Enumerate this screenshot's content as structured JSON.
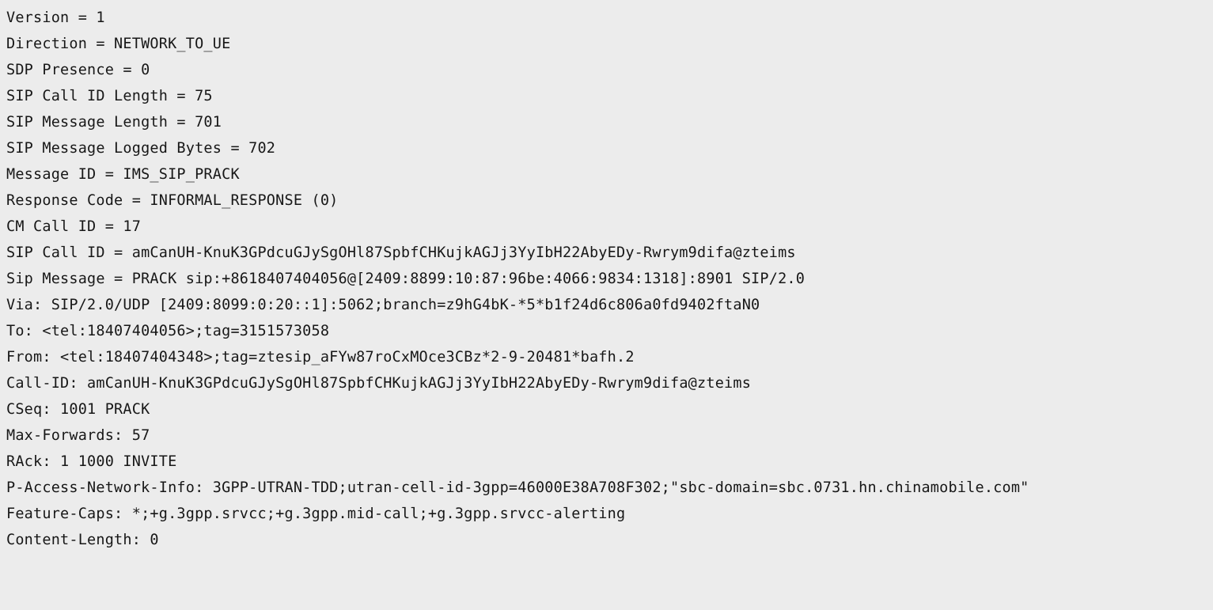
{
  "viewer": {
    "name": "sip-message-log",
    "background_color": "#ececec",
    "text_color": "#171717"
  },
  "log": {
    "lines": [
      {
        "text": "Version = 1"
      },
      {
        "text": "Direction = NETWORK_TO_UE"
      },
      {
        "text": "SDP Presence = 0"
      },
      {
        "text": "SIP Call ID Length = 75"
      },
      {
        "text": "SIP Message Length = 701"
      },
      {
        "text": "SIP Message Logged Bytes = 702"
      },
      {
        "text": "Message ID = IMS_SIP_PRACK"
      },
      {
        "text": "Response Code = INFORMAL_RESPONSE (0)"
      },
      {
        "text": "CM Call ID = 17"
      },
      {
        "text": "SIP Call ID = amCanUH-KnuK3GPdcuGJySgOHl87SpbfCHKujkAGJj3YyIbH22AbyEDy-Rwrym9difa@zteims"
      },
      {
        "text": "Sip Message = PRACK sip:+8618407404056@[2409:8899:10:87:96be:4066:9834:1318]:8901 SIP/2.0"
      },
      {
        "text": "Via: SIP/2.0/UDP [2409:8099:0:20::1]:5062;branch=z9hG4bK-*5*b1f24d6c806a0fd9402ftaN0"
      },
      {
        "text": "To: <tel:18407404056>;tag=3151573058"
      },
      {
        "text": "From: <tel:18407404348>;tag=ztesip_aFYw87roCxMOce3CBz*2-9-20481*bafh.2"
      },
      {
        "text": "Call-ID: amCanUH-KnuK3GPdcuGJySgOHl87SpbfCHKujkAGJj3YyIbH22AbyEDy-Rwrym9difa@zteims"
      },
      {
        "text": "CSeq: 1001 PRACK"
      },
      {
        "text": "Max-Forwards: 57"
      },
      {
        "text": "RAck: 1 1000 INVITE"
      },
      {
        "text": "P-Access-Network-Info: 3GPP-UTRAN-TDD;utran-cell-id-3gpp=46000E38A708F302;\"sbc-domain=sbc.0731.hn.chinamobile.com\""
      },
      {
        "text": "Feature-Caps: *;+g.3gpp.srvcc;+g.3gpp.mid-call;+g.3gpp.srvcc-alerting"
      },
      {
        "text": "Content-Length: 0"
      }
    ]
  }
}
